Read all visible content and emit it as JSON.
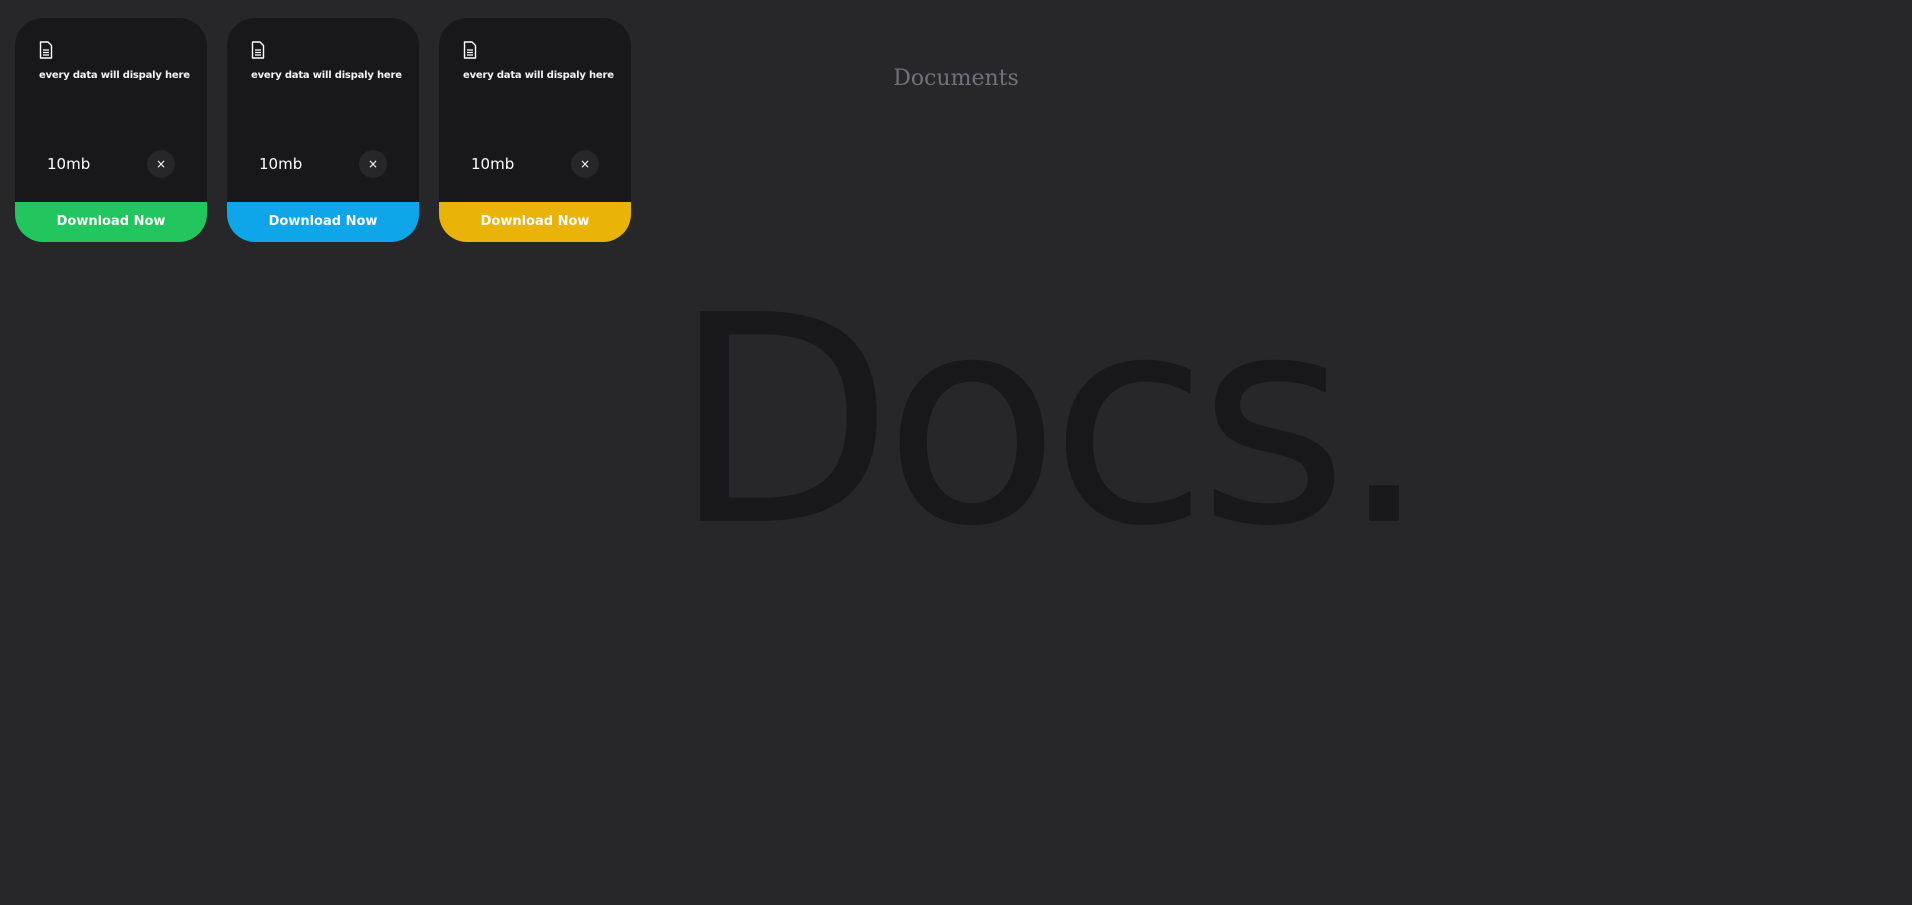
{
  "page": {
    "title": "Documents",
    "background_text": "Docs."
  },
  "cards": [
    {
      "icon": "file-text-icon",
      "description": "every data will dispaly here",
      "size": "10mb",
      "close_symbol": "×",
      "download_label": "Download Now",
      "accent_color": "#22c55e"
    },
    {
      "icon": "file-text-icon",
      "description": "every data will dispaly here",
      "size": "10mb",
      "close_symbol": "×",
      "download_label": "Download Now",
      "accent_color": "#0ea5e9"
    },
    {
      "icon": "file-text-icon",
      "description": "every data will dispaly here",
      "size": "10mb",
      "close_symbol": "×",
      "download_label": "Download Now",
      "accent_color": "#eab308"
    }
  ],
  "colors": {
    "page_background": "#27272a",
    "card_background": "#18181b",
    "title_color": "#71717a",
    "background_text_color": "#18181b"
  }
}
